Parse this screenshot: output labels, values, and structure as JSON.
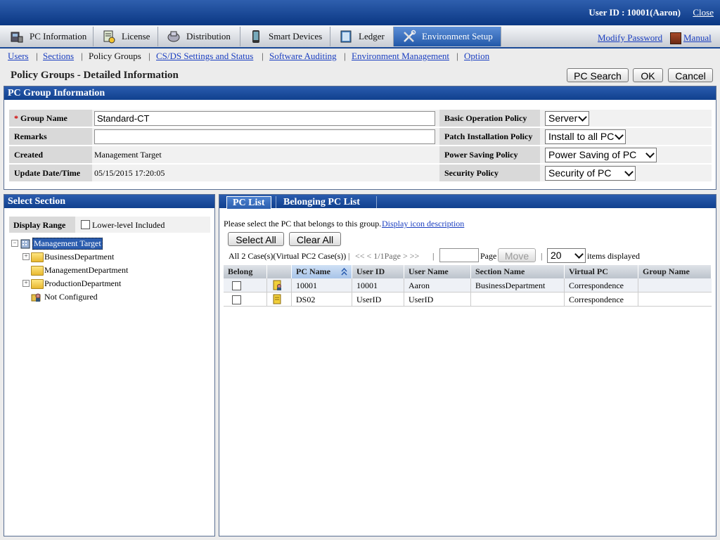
{
  "header": {
    "user_id": "User ID : 10001(Aaron)",
    "close": "Close"
  },
  "tabs": [
    {
      "label": "PC Information",
      "icon": "computer-icon"
    },
    {
      "label": "License",
      "icon": "license-icon"
    },
    {
      "label": "Distribution",
      "icon": "distribution-icon"
    },
    {
      "label": "Smart Devices",
      "icon": "smartphone-icon"
    },
    {
      "label": "Ledger",
      "icon": "ledger-icon"
    },
    {
      "label": "Environment Setup",
      "icon": "tools-icon",
      "active": true
    }
  ],
  "toplinks": {
    "modify_password": "Modify Password",
    "manual": "Manual"
  },
  "subnav": {
    "users": "Users",
    "sections": "Sections",
    "policy_groups": "Policy Groups",
    "csds": "CS/DS Settings and Status",
    "software_auditing": "Software Auditing",
    "env_management": "Environment Management",
    "option": "Option"
  },
  "page": {
    "title": "Policy Groups - Detailed Information"
  },
  "buttons": {
    "pc_search": "PC Search",
    "ok": "OK",
    "cancel": "Cancel"
  },
  "group_info": {
    "header": "PC Group Information",
    "required_mark": "*",
    "group_name_label": "Group Name",
    "group_name_value": "Standard-CT",
    "remarks_label": "Remarks",
    "remarks_value": "",
    "created_label": "Created",
    "created_value": "Management Target",
    "update_label": "Update Date/Time",
    "update_value": "05/15/2015 17:20:05",
    "basic_op_label": "Basic Operation Policy",
    "basic_op_value": "Server",
    "patch_label": "Patch Installation Policy",
    "patch_value": "Install to all PC",
    "power_label": "Power Saving Policy",
    "power_value": "Power Saving of PC",
    "security_label": "Security Policy",
    "security_value": "Security of PC"
  },
  "select_section": {
    "header": "Select Section",
    "display_range": "Display Range",
    "lower_level": "Lower-level Included",
    "tree": [
      "Management Target",
      "BusinessDepartment",
      "ManagementDepartment",
      "ProductionDepartment",
      "Not Configured"
    ]
  },
  "pc_list": {
    "tab_pc_list": "PC List",
    "tab_belonging": "Belonging PC List",
    "instruction": "Please select the PC that belongs to this group.",
    "icon_desc": "Display icon description",
    "select_all": "Select All",
    "clear_all": "Clear All",
    "count": "All 2 Case(s)(Virtual PC2 Case(s))",
    "pager": "<< < 1/1Page > >>",
    "page_label": "Page",
    "move": "Move",
    "per_page": "20",
    "items_displayed": "items displayed",
    "columns": [
      "Belong",
      "",
      "PC Name",
      "User ID",
      "User Name",
      "Section Name",
      "Virtual PC",
      "Group Name"
    ],
    "rows": [
      [
        "",
        "pc-user-icon",
        "10001",
        "10001",
        "Aaron",
        "BusinessDepartment",
        "Correspondence",
        ""
      ],
      [
        "",
        "pc-icon",
        "DS02",
        "UserID",
        "UserID",
        "",
        "Correspondence",
        ""
      ]
    ]
  }
}
